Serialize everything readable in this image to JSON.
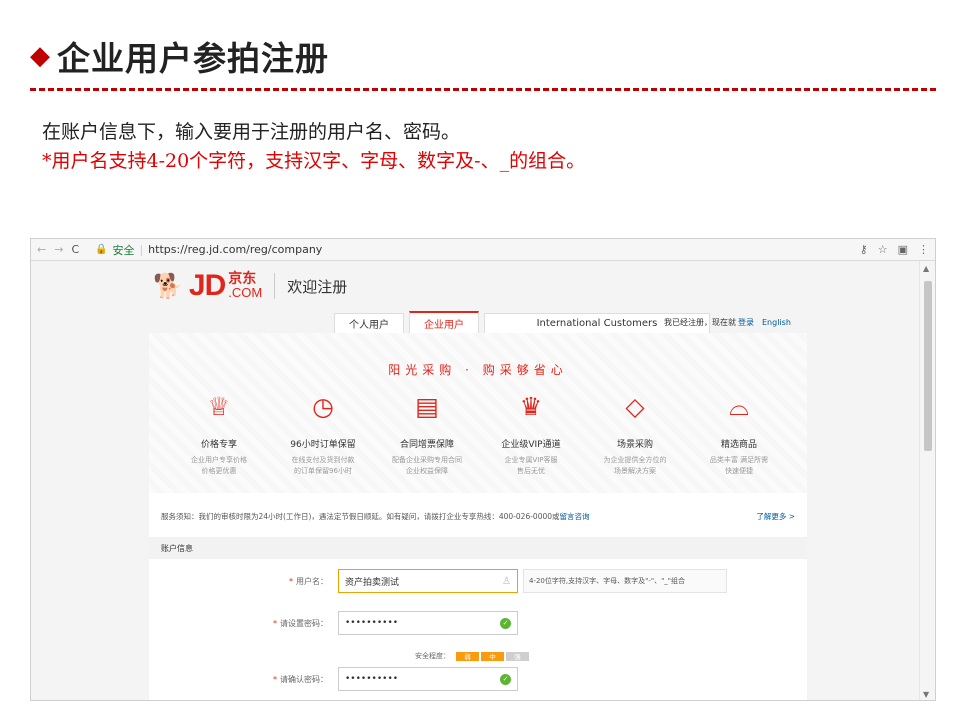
{
  "slide": {
    "title": "企业用户参拍注册",
    "line1": "在账户信息下，输入要用于注册的用户名、密码。",
    "line2": "*用户名支持4-20个字符，支持汉字、字母、数字及-、_的组合。"
  },
  "browser": {
    "nav_back": "←",
    "nav_forward": "→",
    "nav_reload": "C",
    "secure_label": "安全",
    "url": "https://reg.jd.com/reg/company",
    "key_icon": "key-icon",
    "star_icon": "star-icon",
    "menu_icon": "menu-icon"
  },
  "header": {
    "logo_text": "JD",
    "logo_cn": "京东",
    "logo_en": ".COM",
    "welcome": "欢迎注册"
  },
  "tabs": [
    {
      "label": "个人用户"
    },
    {
      "label": "企业用户"
    },
    {
      "label": "International Customers"
    }
  ],
  "login_hint": {
    "text": "我已经注册，现在就",
    "login": "登录",
    "english": "English"
  },
  "banner": {
    "slogan": "阳光采购 · 购采够省心",
    "features": [
      {
        "icon": "trophy-icon",
        "glyph": "🏆",
        "name": "价格专享",
        "desc1": "企业用户专享价格",
        "desc2": "价格更优惠"
      },
      {
        "icon": "clock-icon",
        "glyph": "◷",
        "name": "96小时订单保留",
        "desc1": "在线支付及货到付款",
        "desc2": "的订单保留96小时"
      },
      {
        "icon": "document-icon",
        "glyph": "▤",
        "name": "合同增票保障",
        "desc1": "配备企业采购专用合同",
        "desc2": "企业权益保障"
      },
      {
        "icon": "crown-icon",
        "glyph": "♛",
        "name": "企业级VIP通道",
        "desc1": "企业专属VIP客服",
        "desc2": "售后无忧"
      },
      {
        "icon": "diamond-icon",
        "glyph": "◇",
        "name": "场景采购",
        "desc1": "为企业提供全方位的",
        "desc2": "场景解决方案"
      },
      {
        "icon": "basket-icon",
        "glyph": "⌓",
        "name": "精选商品",
        "desc1": "品类丰富 满足所需",
        "desc2": "快速便捷"
      }
    ]
  },
  "notice": {
    "text": "服务须知：我们的审核时限为24小时(工作日)，遇法定节假日顺延。如有疑问，请拨打企业专享热线：400-026-0000或",
    "link": "留言咨询",
    "more": "了解更多 >"
  },
  "account": {
    "header": "账户信息",
    "username_label": "用户名：",
    "username_value": "资产拍卖测试",
    "username_hint": "4-20位字符,支持汉字、字母、数字及\"-\"、\"_\"组合",
    "password_label": "请设置密码：",
    "password_value": "••••••••••",
    "strength_label": "安全程度：",
    "strength_weak": "弱",
    "strength_mid": "中",
    "strength_strong": "强",
    "confirm_label": "请确认密码：",
    "confirm_value": "••••••••••"
  }
}
